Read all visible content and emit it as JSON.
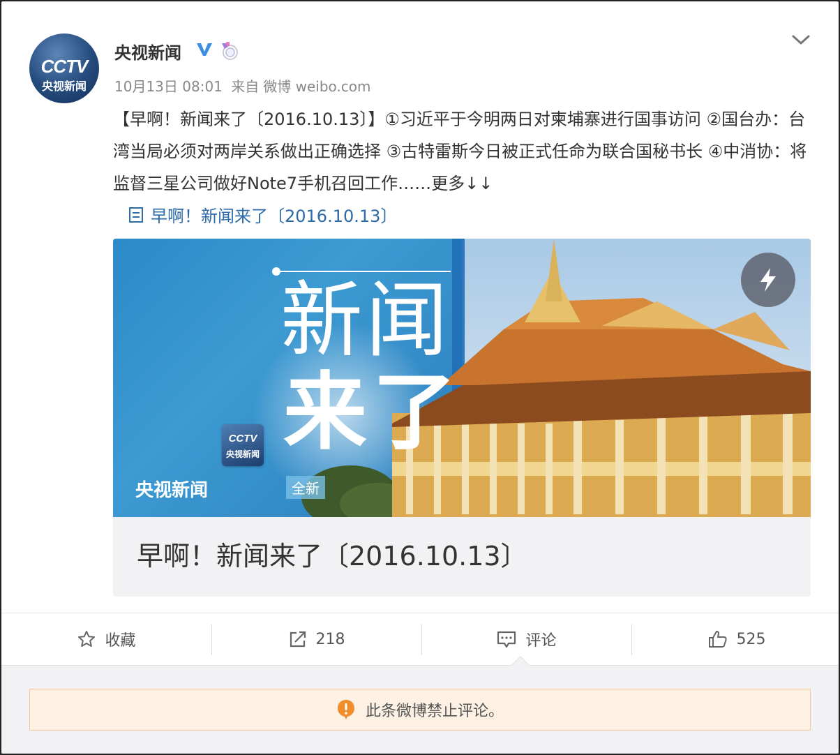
{
  "post": {
    "avatar": {
      "logo_text": "CCTV",
      "logo_subtext": "央视新闻"
    },
    "username": "央视新闻",
    "time": "10月13日 08:01",
    "source_prefix": "来自",
    "source": "微博 weibo.com",
    "text": "【早啊！新闻来了〔2016.10.13〕】①习近平于今明两日对柬埔寨进行国事访问 ②国台办：台湾当局必须对两岸关系做出正确选择 ③古特雷斯今日被正式任命为联合国秘书长 ④中消协：将监督三星公司做好Note7手机召回工作……",
    "more_label": "更多↓↓",
    "article_link": "早啊！新闻来了〔2016.10.13〕"
  },
  "article_card": {
    "cover_big_line1": "新闻",
    "cover_big_line2": "来了",
    "cover_small": "全新",
    "cover_logo_text": "CCTV",
    "cover_logo_subtext": "央视新闻",
    "cover_brand": "央视新闻",
    "title": "早啊！新闻来了〔2016.10.13〕"
  },
  "actions": {
    "favorite_label": "收藏",
    "repost_count": "218",
    "comment_label": "评论",
    "like_count": "525"
  },
  "comments": {
    "notice": "此条微博禁止评论。"
  },
  "colors": {
    "link": "#2c6aa8",
    "verified": "#3b8fe0",
    "warning": "#f08d2c"
  }
}
